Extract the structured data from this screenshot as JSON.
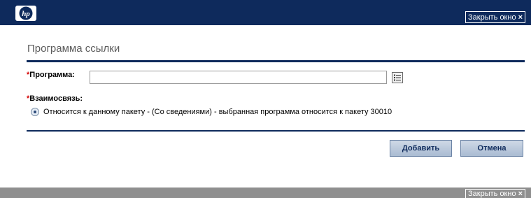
{
  "header": {
    "logo_icon": "hp-logo",
    "close_label": "Закрыть окно",
    "close_icon": "close-x-icon",
    "close_glyph": "×"
  },
  "form": {
    "title": "Программа ссылки",
    "required_mark": "*",
    "program_label": "Программа:",
    "program_value": "",
    "program_picker_icon": "list-picker-icon",
    "relation_label": "Взаимосвязь:",
    "relation_option": {
      "selected": true,
      "label": "Относится к данному пакету - (Со сведениями) - выбранная программа относится к пакету 30010"
    }
  },
  "actions": {
    "add_label": "Добавить",
    "cancel_label": "Отмена"
  },
  "footer": {
    "close_label": "Закрыть окно",
    "close_glyph": "×"
  },
  "colors": {
    "header_bg": "#0e2a5c",
    "footer_bg": "#8f8f8f",
    "required": "#d40000",
    "title_text": "#5c5c5c"
  }
}
